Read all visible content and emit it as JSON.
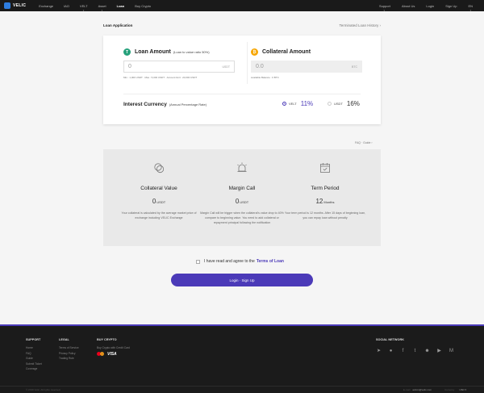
{
  "nav": {
    "logo": "VELIC",
    "left": [
      "Exchange",
      "IAO",
      "VELT",
      "Asset",
      "Loan",
      "Buy Crypto"
    ],
    "right": [
      "Support",
      "About Us",
      "Login",
      "Sign Up",
      "EN"
    ],
    "active": "Loan"
  },
  "loan": {
    "title": "Loan Application",
    "history_link": "Terminated Loan History",
    "loan_amount": {
      "icon": "tether-coin-icon",
      "label": "Loan Amount",
      "note": "(Loan to value ratio 50%)",
      "value": "0",
      "unit": "USDT",
      "hint": "Min : 1,000 USDT · Max : 5,000 USDT · Account limit : 20,000 USDT"
    },
    "collateral": {
      "icon": "bitcoin-coin-icon",
      "label": "Collateral Amount",
      "value": "0.0",
      "unit": "BTC",
      "hint": "Available Balance : 0 BTC"
    },
    "interest": {
      "label": "Interest Currency",
      "note": "(Annual Percentage Rate)",
      "options": [
        {
          "name": "VELT",
          "rate": "11%",
          "selected": true
        },
        {
          "name": "USDT",
          "rate": "16%",
          "selected": false
        }
      ]
    }
  },
  "faq_link": "FAQ · Guide",
  "info": [
    {
      "icon": "coins-icon",
      "title": "Collateral Value",
      "value": "0",
      "unit": "USDT",
      "desc": "Your collateral is calculated by the average market price of exchange including VELIC Exchange"
    },
    {
      "icon": "alarm-icon",
      "title": "Margin Call",
      "value": "0",
      "unit": "USDT",
      "desc": "Margin Call will be trigger when the collateral's value drop to 40% compare to beginning value. You need to add collateral or repayment principal following the notification"
    },
    {
      "icon": "calendar-icon",
      "title": "Term Period",
      "value": "12",
      "unit": "Months",
      "desc": "Your term period is 12 months. After 15 days of beginning loan, you can repay loan without penalty"
    }
  ],
  "agree": {
    "text": "I have read and agree to the",
    "terms": "Terms of Loan"
  },
  "login_button": "Login  ·  Sign Up",
  "footer": {
    "support": {
      "head": "SUPPORT",
      "links": [
        "Home",
        "FAQ",
        "Guide",
        "Submit Ticket",
        "Coverage"
      ]
    },
    "legal": {
      "head": "LEGAL",
      "links": [
        "Terms of Service",
        "Privacy Policy",
        "Trading Rule"
      ]
    },
    "buy": {
      "head": "BUY CRYPTO",
      "text": "Buy Crypto with Credit Card",
      "visa": "VISA"
    },
    "social": {
      "head": "SOCIAL NETWORK",
      "icons": [
        "telegram-icon",
        "kakaotalk-icon",
        "facebook-icon",
        "twitter-icon",
        "reddit-icon",
        "youtube-icon",
        "medium-icon"
      ]
    },
    "copyright": "© 2019 Velic. All rights reserved.",
    "email_label": "E-mail",
    "email": "admin@velic.com",
    "currency_label": "Currency",
    "currency": "USD"
  }
}
